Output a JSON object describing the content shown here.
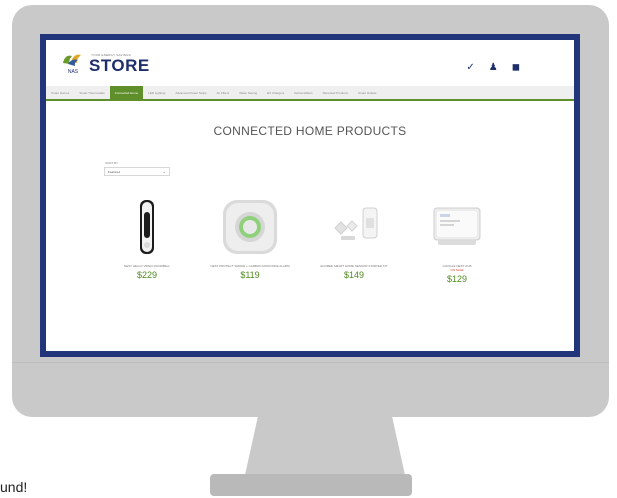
{
  "store": {
    "tagline": "YOUR ENERGY SAVINGS",
    "logo_text": "NAS",
    "name": "STORE"
  },
  "header_icons": [
    "phone-icon",
    "user-icon",
    "cart-icon"
  ],
  "nav": [
    {
      "label": "Smart Homes",
      "active": false
    },
    {
      "label": "Smart Thermostats",
      "active": false
    },
    {
      "label": "Connected Home",
      "active": true
    },
    {
      "label": "LED Lighting",
      "active": false
    },
    {
      "label": "Advanced Power Strips",
      "active": false
    },
    {
      "label": "Air Filters",
      "active": false
    },
    {
      "label": "Water Saving",
      "active": false
    },
    {
      "label": "EV Chargers",
      "active": false
    },
    {
      "label": "Dehumidifiers",
      "active": false
    },
    {
      "label": "Renewed Products",
      "active": false
    },
    {
      "label": "Smart Outlets",
      "active": false
    }
  ],
  "page_title": "CONNECTED HOME PRODUCTS",
  "sort": {
    "label": "SORT BY",
    "value": "Featured"
  },
  "products": [
    {
      "name": "NEST HELLO VIDEO DOORBELL",
      "sale": "",
      "price": "$229"
    },
    {
      "name": "NEST PROTECT SMOKE + CARBON MONOXIDE ALARM",
      "sale": "",
      "price": "$119"
    },
    {
      "name": "ECOBEE SMART HOME SENSOR STARTER KIT",
      "sale": "",
      "price": "$149"
    },
    {
      "name": "GOOGLE NEST HUB",
      "sale": "ON SALE",
      "price": "$129"
    }
  ],
  "bottom_text": "und!"
}
